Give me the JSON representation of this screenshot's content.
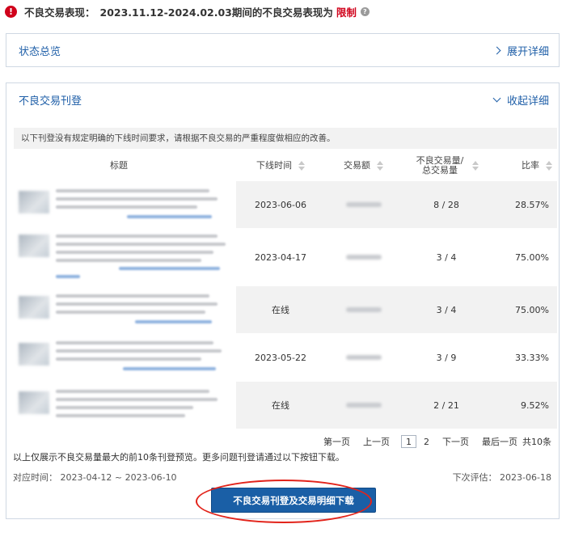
{
  "status_bar": {
    "label": "不良交易表现：",
    "text": "2023.11.12-2024.02.03期间的不良交易表现为",
    "status": "限制",
    "icon": "error-icon",
    "status_color": "#d0021b"
  },
  "overview_panel": {
    "title": "状态总览",
    "toggle_label": "展开详细"
  },
  "listing_panel": {
    "title": "不良交易刊登",
    "toggle_label": "收起详细",
    "notice": "以下刊登没有规定明确的下线时间要求，请根据不良交易的严重程度做相应的改善。",
    "columns": [
      "标题",
      "下线时间",
      "交易额",
      "不良交易量/总交易量",
      "比率"
    ],
    "rows": [
      {
        "offline_time": "2023-06-06",
        "ratio_count": "8 / 28",
        "rate": "28.57%"
      },
      {
        "offline_time": "2023-04-17",
        "ratio_count": "3 / 4",
        "rate": "75.00%"
      },
      {
        "offline_time": "在线",
        "ratio_count": "3 / 4",
        "rate": "75.00%"
      },
      {
        "offline_time": "2023-05-22",
        "ratio_count": "3 / 9",
        "rate": "33.33%"
      },
      {
        "offline_time": "在线",
        "ratio_count": "2 / 21",
        "rate": "9.52%"
      }
    ],
    "pager": {
      "first": "第一页",
      "prev": "上一页",
      "current": "1",
      "page2": "2",
      "next": "下一页",
      "last": "最后一页",
      "total": "共10条"
    },
    "footnote": "以上仅展示不良交易量最大的前10条刊登预览。更多问题刊登请通过以下按钮下载。",
    "period": "对应时间：  2023-04-12 ~ 2023-06-10",
    "next_eval": "下次评估：  2023-06-18",
    "download_button": "不良交易刊登及交易明细下载"
  },
  "colors": {
    "accent": "#1f5fa8",
    "button": "#1a5fa6",
    "highlight_ring": "#e2231a"
  }
}
